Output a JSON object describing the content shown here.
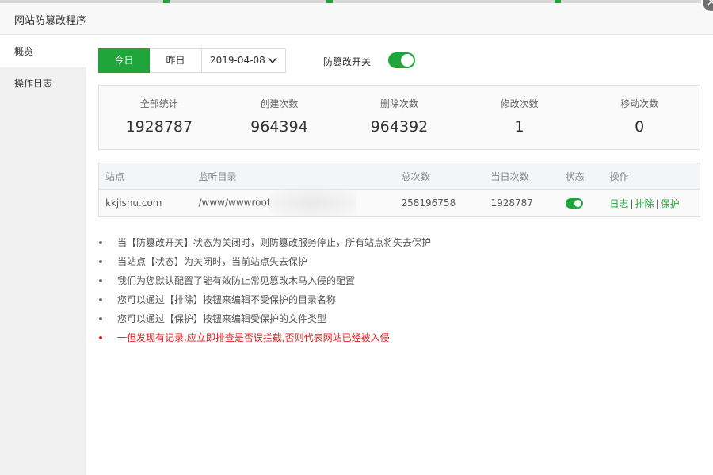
{
  "window": {
    "title": "网站防篡改程序",
    "close_icon": "close-icon"
  },
  "sidebar": {
    "items": [
      {
        "label": "概览",
        "active": true
      },
      {
        "label": "操作日志",
        "active": false
      }
    ]
  },
  "filter": {
    "today": "今日",
    "yesterday": "昨日",
    "date": "2019-04-08",
    "switch_label": "防篡改开关",
    "switch_on": true
  },
  "stats": [
    {
      "label": "全部统计",
      "value": "1928787"
    },
    {
      "label": "创建次数",
      "value": "964394"
    },
    {
      "label": "删除次数",
      "value": "964392"
    },
    {
      "label": "修改次数",
      "value": "1"
    },
    {
      "label": "移动次数",
      "value": "0"
    }
  ],
  "table": {
    "headers": [
      "站点",
      "监听目录",
      "总次数",
      "当日次数",
      "状态",
      "操作"
    ],
    "rows": [
      {
        "site": "kkjishu.com",
        "dir": "/www/wwwroot",
        "total": "258196758",
        "today": "1928787",
        "status_on": true,
        "ops": [
          "日志",
          "排除",
          "保护"
        ]
      }
    ]
  },
  "notes": [
    "当【防篡改开关】状态为关闭时，则防篡改服务停止，所有站点将失去保护",
    "当站点【状态】为关闭时，当前站点失去保护",
    "我们为您默认配置了能有效防止常见篡改木马入侵的配置",
    "您可以通过【排除】按钮来编辑不受保护的目录名称",
    "您可以通过【保护】按钮来编辑受保护的文件类型",
    "一但发现有记录,应立即排查是否误拦截,否则代表网站已经被入侵"
  ],
  "colors": {
    "accent": "#20a53a",
    "warning": "#e02020"
  }
}
